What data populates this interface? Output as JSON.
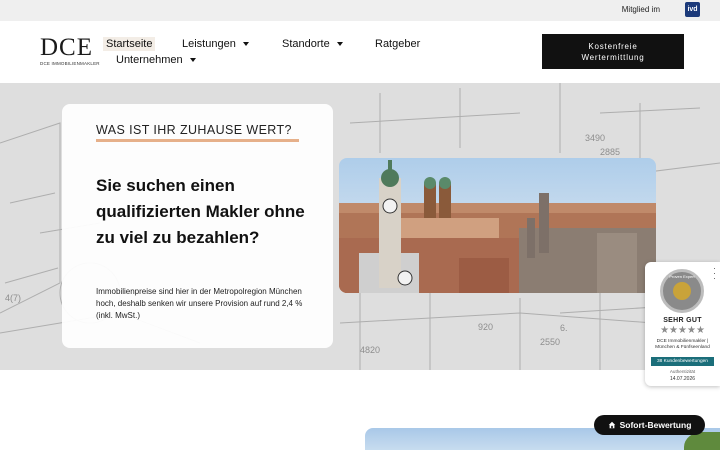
{
  "topbar": {
    "member_label": "Mitglied im",
    "ivd_logo": "ivd"
  },
  "logo": {
    "mark": "DCE",
    "subtitle": "DCE IMMOBILIENMAKLER"
  },
  "nav": {
    "items": [
      {
        "label": "Startseite",
        "active": true,
        "has_dropdown": false
      },
      {
        "label": "Leistungen",
        "active": false,
        "has_dropdown": true
      },
      {
        "label": "Standorte",
        "active": false,
        "has_dropdown": true
      },
      {
        "label": "Ratgeber",
        "active": false,
        "has_dropdown": false
      },
      {
        "label": "Unternehmen",
        "active": false,
        "has_dropdown": true
      }
    ]
  },
  "cta": {
    "line1": "Kostenfreie",
    "line2": "Wertermittlung"
  },
  "hero": {
    "kicker": "WAS IST IHR ZUHAUSE WERT?",
    "headline": "Sie suchen einen qualifizierten Makler ohne zu viel zu bezahlen?",
    "body": "Immobilienpreise sind hier in der Metropolregion München hoch, deshalb senken wir unsere Provision auf rund 2,4 % (inkl. MwSt.)"
  },
  "badge": {
    "seal_text": "Proven Expert",
    "rating_label": "SEHR GUT",
    "stars": 5,
    "company": "DCE Immobilienmakler | München & Fünfseenland",
    "reviews": "38 Kundenbewertungen",
    "authenticity": "Authentizität",
    "date": "14.07.2026"
  },
  "floating_button": {
    "label": "Sofort-Bewertung",
    "icon": "home-icon"
  },
  "colors": {
    "accent_line": "#e6b08a",
    "cta_bg": "#111111",
    "badge_teal": "#1b6e7a",
    "nav_active_bg": "#f3ede6"
  }
}
